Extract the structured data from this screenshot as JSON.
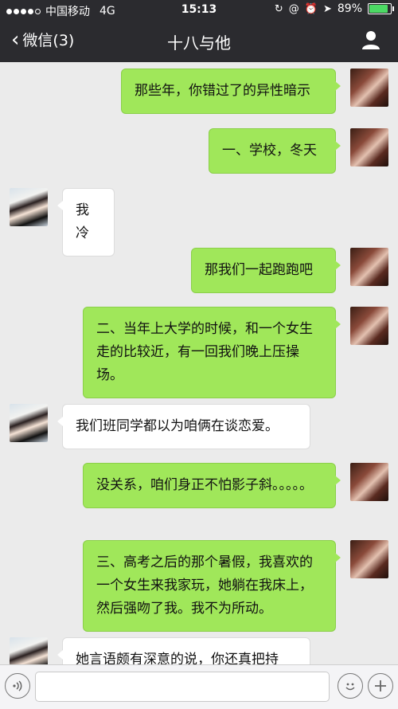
{
  "status_bar": {
    "carrier": "中国移动",
    "network": "4G",
    "time": "15:13",
    "battery": "89%",
    "battery_level": 0.89,
    "battery_color": "#4cd964"
  },
  "nav": {
    "back_label": "微信(3)",
    "title": "十八与他",
    "profile_icon": "person-icon"
  },
  "messages": [
    {
      "from": "me",
      "text": "那些年，你错过了的异性暗示"
    },
    {
      "from": "me",
      "text": "一、学校，冬天"
    },
    {
      "from": "other",
      "text": "我冷"
    },
    {
      "from": "me",
      "text": "那我们一起跑跑吧"
    },
    {
      "from": "me",
      "text": "二、当年上大学的时候，和一个女生走的比较近，有一回我们晚上压操场。"
    },
    {
      "from": "other",
      "text": "我们班同学都以为咱俩在谈恋爱。"
    },
    {
      "from": "me",
      "text": "没关系，咱们身正不怕影子斜。。。。。"
    },
    {
      "from": "me",
      "text": "三、高考之后的那个暑假，我喜欢的一个女生来我家玩，她躺在我床上，然后强吻了我。我不为所动。"
    },
    {
      "from": "other",
      "text": "她言语颇有深意的说，你还真把持"
    }
  ],
  "input_bar": {
    "voice_icon": "voice-icon",
    "emoji_icon": "emoji-icon",
    "plus_icon": "plus-icon"
  },
  "colors": {
    "header": "#2b2b2f",
    "chat_bg": "#ebebeb",
    "my_bubble": "#a0e75a",
    "other_bubble": "#ffffff"
  }
}
